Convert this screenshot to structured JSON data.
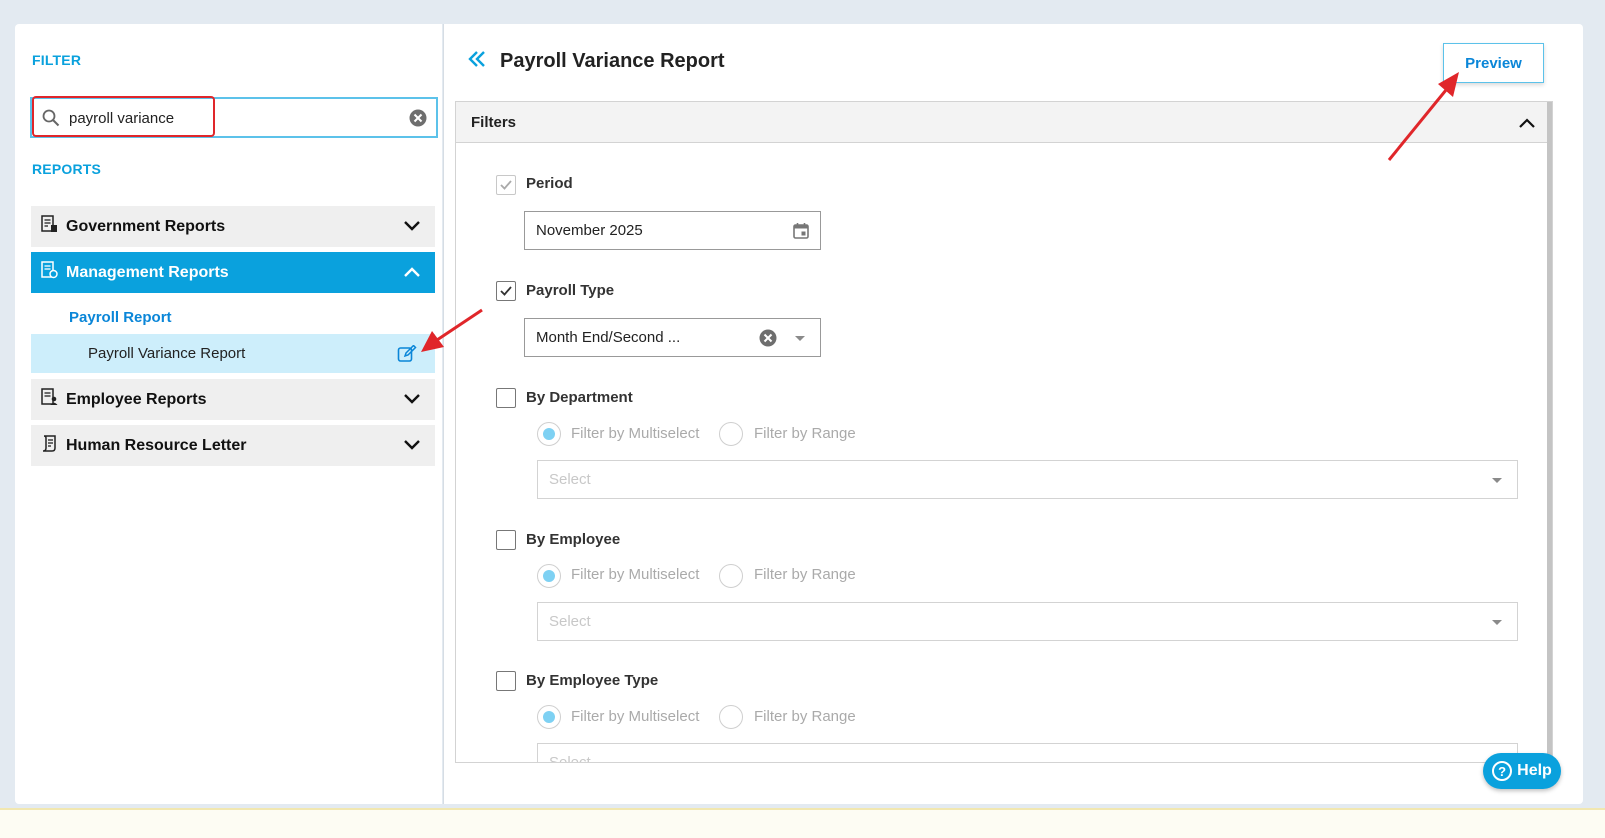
{
  "sidebar": {
    "filter_label": "FILTER",
    "search": {
      "value": "payroll variance",
      "placeholder": ""
    },
    "reports_label": "REPORTS",
    "groups": [
      {
        "label": "Government Reports",
        "expanded": false
      },
      {
        "label": "Management Reports",
        "expanded": true
      },
      {
        "label": "Employee Reports",
        "expanded": false
      },
      {
        "label": "Human Resource Letter",
        "expanded": false
      }
    ],
    "subgroup": "Payroll Report",
    "subitem": "Payroll Variance Report"
  },
  "main": {
    "title": "Payroll Variance Report",
    "preview_label": "Preview",
    "filters_label": "Filters",
    "period": {
      "label": "Period",
      "checked": true,
      "value": "November 2025"
    },
    "payroll_type": {
      "label": "Payroll Type",
      "checked": true,
      "value": "Month End/Second ..."
    },
    "by_department": {
      "label": "By Department",
      "checked": false,
      "opt_multi": "Filter by Multiselect",
      "opt_range": "Filter by Range",
      "select_placeholder": "Select"
    },
    "by_employee": {
      "label": "By Employee",
      "checked": false,
      "opt_multi": "Filter by Multiselect",
      "opt_range": "Filter by Range",
      "select_placeholder": "Select"
    },
    "by_employee_type": {
      "label": "By Employee Type",
      "checked": false,
      "opt_multi": "Filter by Multiselect",
      "opt_range": "Filter by Range",
      "select_placeholder": "Select"
    }
  },
  "help_label": "Help",
  "colors": {
    "accent": "#0aa1dd",
    "highlight_row": "#cdeefb",
    "annotation": "#e0262a"
  }
}
